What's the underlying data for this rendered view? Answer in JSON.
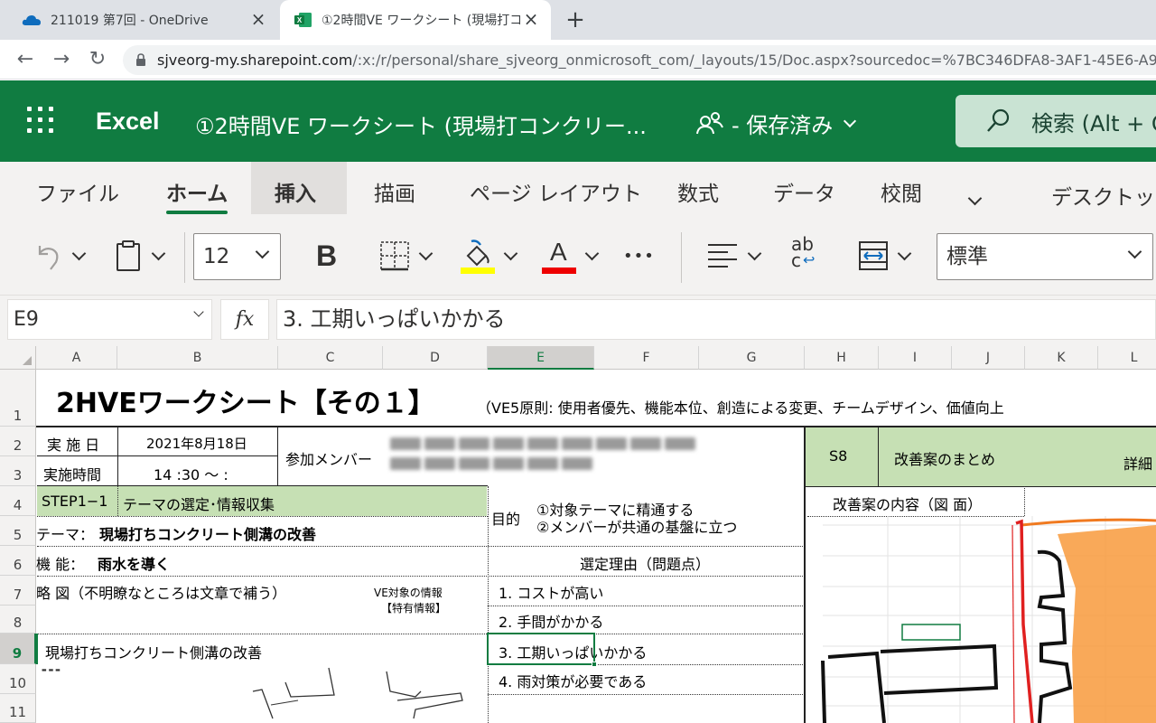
{
  "browser": {
    "tabs": [
      {
        "title": "211019 第7回 - OneDrive",
        "active": false
      },
      {
        "title": "①2時間VE ワークシート (現場打コン",
        "active": true
      }
    ],
    "url_host": "sjveorg-my.sharepoint.com",
    "url_path": "/:x:/r/personal/share_sjveorg_onmicrosoft_com/_layouts/15/Doc.aspx?sourcedoc=%7BC346DFA8-3AF1-45E6-A9F7-5"
  },
  "excel": {
    "app_name": "Excel",
    "doc_title": "①2時間VE ワークシート (現場打コンクリー...",
    "save_status": "- 保存済み",
    "search_placeholder": "検索 (Alt + Q"
  },
  "ribbon": {
    "tabs": [
      "ファイル",
      "ホーム",
      "挿入",
      "描画",
      "ページ レイアウト",
      "数式",
      "データ",
      "校閲"
    ],
    "selected_tab": "ホーム",
    "desktop_label": "デスクトップ",
    "bold_label": "B",
    "font_size": "12",
    "number_format": "標準",
    "font_color_label": "A",
    "more_label": "•••",
    "wrap_label": "ab",
    "wrap_label2": "c"
  },
  "formula_bar": {
    "name_box": "E9",
    "fx_label": "fx",
    "formula": "3. 工期いっぱいかかる"
  },
  "grid": {
    "columns": [
      "A",
      "B",
      "C",
      "D",
      "E",
      "F",
      "G",
      "H",
      "I",
      "J",
      "K",
      "L"
    ],
    "active_column": "E",
    "rows": [
      "1",
      "2",
      "3",
      "4",
      "5",
      "6",
      "7",
      "8",
      "9",
      "10",
      "11"
    ],
    "active_row": "9",
    "cells": {
      "title": "2HVEワークシート【その１】",
      "subtitle": "（VE5原則: 使用者優先、機能本位、創造による変更、チームデザイン、価値向上",
      "date_label": "実 施 日",
      "date_value": "2021年8月18日",
      "time_label": "実施時間",
      "time_value": "14 :30 〜 :",
      "members_label": "参加メンバー",
      "s8": "S8",
      "s8_title": "改善案のまとめ",
      "detail": "詳細",
      "step": "STEP1−1",
      "step_title": "テーマの選定･情報収集",
      "purpose_label": "目的",
      "purpose_1": "①対象テーマに精通する",
      "purpose_2": "②メンバーが共通の基盤に立つ",
      "improve_content": "改善案の内容（図 面）",
      "theme_label": "テーマ：",
      "theme_value": "現場打ちコンクリート側溝の改善",
      "function_label": "機 能：",
      "function_value": "雨水を導く",
      "reason_header": "選定理由（問題点）",
      "sketch_label": "略 図（不明瞭なところは文章で補う）",
      "ve_info_1": "VE対象の情報",
      "ve_info_2": "【特有情報】",
      "reason_1": "1. コストが高い",
      "reason_2": "2. 手間がかかる",
      "reason_3": "3. 工期いっぱいかかる",
      "reason_4": "4. 雨対策が必要である",
      "sketch_title": "現場打ちコンクリート側溝の改善"
    }
  }
}
